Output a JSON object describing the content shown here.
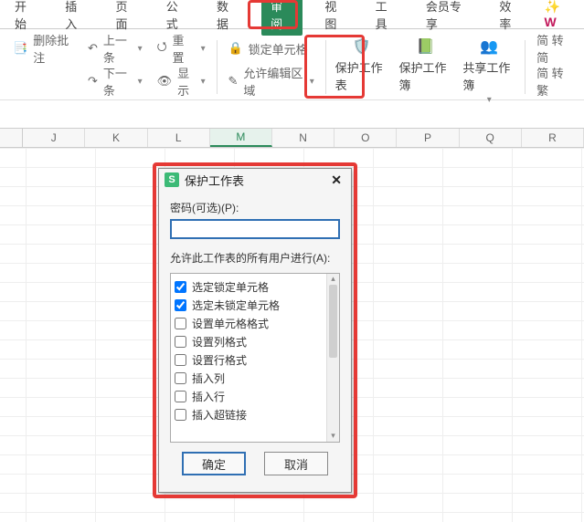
{
  "tabs": [
    "开始",
    "插入",
    "页面",
    "公式",
    "数据",
    "审阅",
    "视图",
    "工具",
    "会员专享",
    "效率"
  ],
  "active_tab_index": 5,
  "ribbon": {
    "left1_top": "上一条",
    "left1_bot": "下一条",
    "delete_annot": "删除批注",
    "reset": "重置",
    "show": "显示",
    "lock_cells": "锁定单元格",
    "allow_edit": "允许编辑区域",
    "protect_sheet": "保护工作表",
    "protect_book": "保护工作簿",
    "share_book": "共享工作簿",
    "simp_trad1": "简 转简",
    "simp_trad2": "简 转繁"
  },
  "columns": [
    "J",
    "K",
    "L",
    "M",
    "N",
    "O",
    "P",
    "Q",
    "R"
  ],
  "selected_col_index": 3,
  "dialog": {
    "title": "保护工作表",
    "pw_label": "密码(可选)(P):",
    "allow_label": "允许此工作表的所有用户进行(A):",
    "options": [
      {
        "label": "选定锁定单元格",
        "checked": true
      },
      {
        "label": "选定未锁定单元格",
        "checked": true
      },
      {
        "label": "设置单元格格式",
        "checked": false
      },
      {
        "label": "设置列格式",
        "checked": false
      },
      {
        "label": "设置行格式",
        "checked": false
      },
      {
        "label": "插入列",
        "checked": false
      },
      {
        "label": "插入行",
        "checked": false
      },
      {
        "label": "插入超链接",
        "checked": false
      }
    ],
    "ok": "确定",
    "cancel": "取消"
  }
}
